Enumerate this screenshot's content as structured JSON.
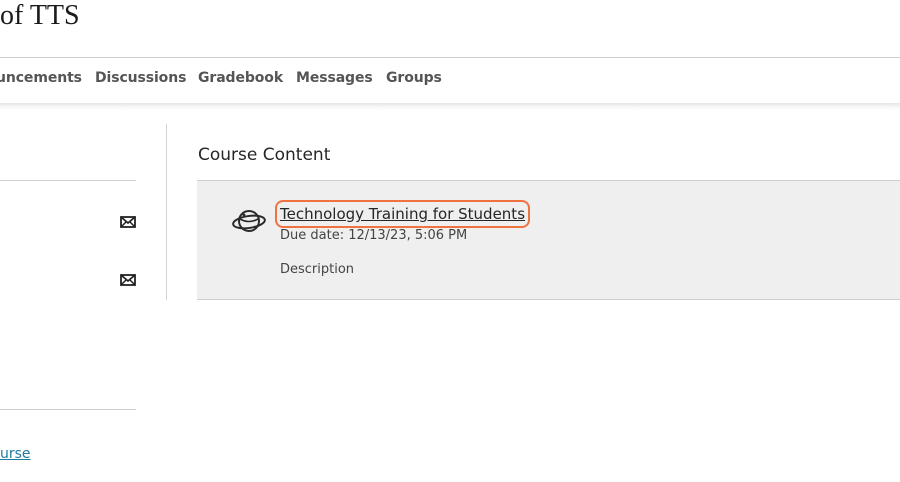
{
  "course": {
    "title": "of TTS"
  },
  "nav": {
    "tabs": [
      {
        "label": "uncements"
      },
      {
        "label": "Discussions"
      },
      {
        "label": "Gradebook"
      },
      {
        "label": "Messages"
      },
      {
        "label": "Groups"
      }
    ]
  },
  "sidebar": {
    "icons": [
      "mail-icon",
      "mail-icon"
    ],
    "course_link": "urse"
  },
  "content": {
    "heading": "Course Content",
    "item": {
      "icon": "planet-icon",
      "title": "Technology Training for Students",
      "due": "Due date: 12/13/23, 5:06 PM",
      "description": "Description"
    }
  },
  "colors": {
    "highlight": "#f07241",
    "link": "#1f7a9c",
    "item_bg": "#efefef"
  }
}
